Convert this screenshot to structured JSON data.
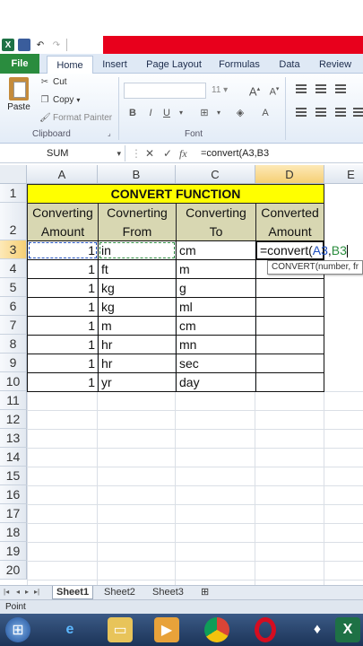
{
  "ribbon": {
    "tabs": [
      "File",
      "Home",
      "Insert",
      "Page Layout",
      "Formulas",
      "Data",
      "Review"
    ],
    "clipboard": {
      "paste_label": "Paste",
      "cut_label": "Cut",
      "copy_label": "Copy",
      "format_painter_label": "Format Painter",
      "group_label": "Clipboard"
    },
    "font": {
      "size": "11",
      "group_label": "Font"
    }
  },
  "formula_bar": {
    "name_box": "SUM",
    "fx": "fx",
    "formula": "=convert(A3,B3"
  },
  "grid": {
    "columns": [
      "A",
      "B",
      "C",
      "D",
      "E"
    ],
    "rows": [
      "1",
      "2",
      "3",
      "4",
      "5",
      "6",
      "7",
      "8",
      "9",
      "10",
      "11",
      "12",
      "13",
      "14",
      "15",
      "16",
      "17",
      "18",
      "19",
      "20"
    ],
    "title": "CONVERT FUNCTION",
    "headers": [
      [
        "Converting",
        "Amount"
      ],
      [
        "Covnerting",
        "From"
      ],
      [
        "Converting",
        "To"
      ],
      [
        "Converted",
        "Amount"
      ]
    ],
    "data_rows": [
      {
        "amount": "1",
        "from": "in",
        "to": "cm"
      },
      {
        "amount": "1",
        "from": "ft",
        "to": "m"
      },
      {
        "amount": "1",
        "from": "kg",
        "to": "g"
      },
      {
        "amount": "1",
        "from": "kg",
        "to": "ml"
      },
      {
        "amount": "1",
        "from": "m",
        "to": "cm"
      },
      {
        "amount": "1",
        "from": "hr",
        "to": "mn"
      },
      {
        "amount": "1",
        "from": "hr",
        "to": "sec"
      },
      {
        "amount": "1",
        "from": "yr",
        "to": "day"
      }
    ],
    "editing_cell": {
      "prefix": "=convert(",
      "ref1": "A3",
      "comma": ",",
      "ref2": "B3"
    },
    "tooltip": "CONVERT(number, fr"
  },
  "sheets": [
    "Sheet1",
    "Sheet2",
    "Sheet3"
  ],
  "status": "Point",
  "colors": {
    "title_fill": "#ffff00",
    "header_fill": "#d8d7b2",
    "file_tab": "#2a8c3e",
    "accent_red": "#e8001c"
  }
}
